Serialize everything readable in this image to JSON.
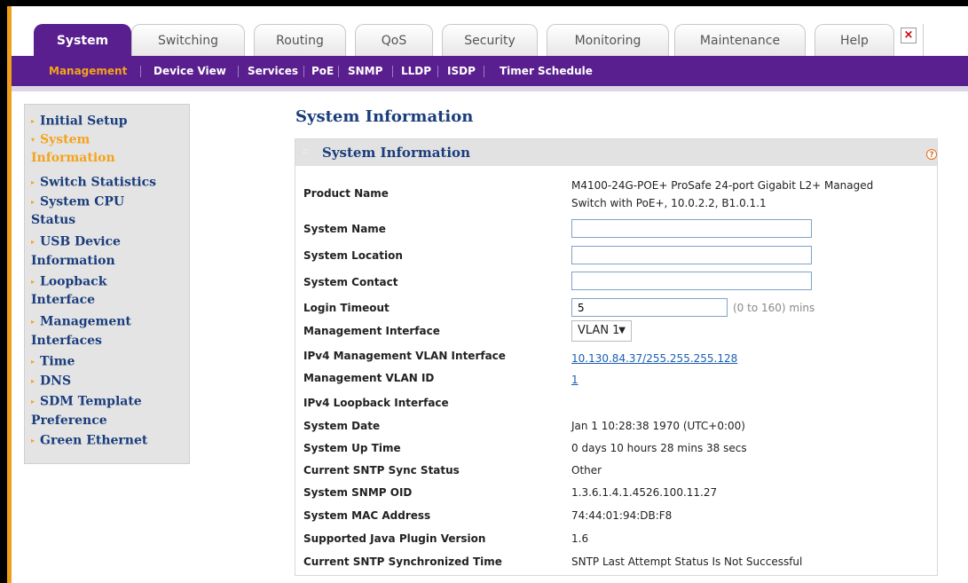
{
  "tabs": [
    "System",
    "Switching",
    "Routing",
    "QoS",
    "Security",
    "Monitoring",
    "Maintenance",
    "Help"
  ],
  "close_glyph": "×",
  "subnav": [
    "Management",
    "Device View",
    "Services",
    "PoE",
    "SNMP",
    "LLDP",
    "ISDP",
    "Timer Schedule"
  ],
  "sidebar": [
    {
      "label": "Initial Setup"
    },
    {
      "label": "System"
    },
    {
      "label": "Information"
    },
    {
      "label": "Switch Statistics"
    },
    {
      "label": "System CPU"
    },
    {
      "label": "Status"
    },
    {
      "label": "USB Device"
    },
    {
      "label": "Information"
    },
    {
      "label": "Loopback"
    },
    {
      "label": "Interface"
    },
    {
      "label": "Management"
    },
    {
      "label": "Interfaces"
    },
    {
      "label": "Time"
    },
    {
      "label": "DNS"
    },
    {
      "label": "SDM Template"
    },
    {
      "label": "Preference"
    },
    {
      "label": "Green Ethernet"
    }
  ],
  "page_title": "System Information",
  "panel_title": "System Information",
  "help_glyph": "?",
  "fields": {
    "product_name": {
      "label": "Product Name",
      "value_line1": "M4100-24G-POE+ ProSafe 24-port Gigabit L2+ Managed",
      "value_line2": "Switch with PoE+, 10.0.2.2, B1.0.1.1"
    },
    "system_name": {
      "label": "System Name",
      "value": ""
    },
    "system_location": {
      "label": "System Location",
      "value": ""
    },
    "system_contact": {
      "label": "System Contact",
      "value": ""
    },
    "login_timeout": {
      "label": "Login Timeout",
      "value": "5",
      "note": "(0 to 160) mins"
    },
    "management_interface": {
      "label": "Management Interface",
      "value": "VLAN 1"
    },
    "ipv4_mgmt_vlan_interface": {
      "label": "IPv4 Management VLAN Interface",
      "value": "10.130.84.37/255.255.255.128"
    },
    "management_vlan_id": {
      "label": "Management VLAN ID",
      "value": "1"
    },
    "ipv4_loopback_interface": {
      "label": "IPv4 Loopback Interface",
      "value": ""
    },
    "system_date": {
      "label": "System Date",
      "value": "Jan 1 10:28:38 1970 (UTC+0:00)"
    },
    "system_up_time": {
      "label": "System Up Time",
      "value": "0 days 10 hours 28 mins 38 secs"
    },
    "sntp_sync_status": {
      "label": "Current SNTP Sync Status",
      "value": "Other"
    },
    "snmp_oid": {
      "label": "System SNMP OID",
      "value": "1.3.6.1.4.1.4526.100.11.27"
    },
    "mac_address": {
      "label": "System MAC Address",
      "value": "74:44:01:94:DB:F8"
    },
    "java_plugin": {
      "label": "Supported Java Plugin Version",
      "value": "1.6"
    },
    "sntp_sync_time": {
      "label": "Current SNTP Synchronized Time",
      "value": "SNTP Last Attempt Status Is Not Successful"
    }
  }
}
